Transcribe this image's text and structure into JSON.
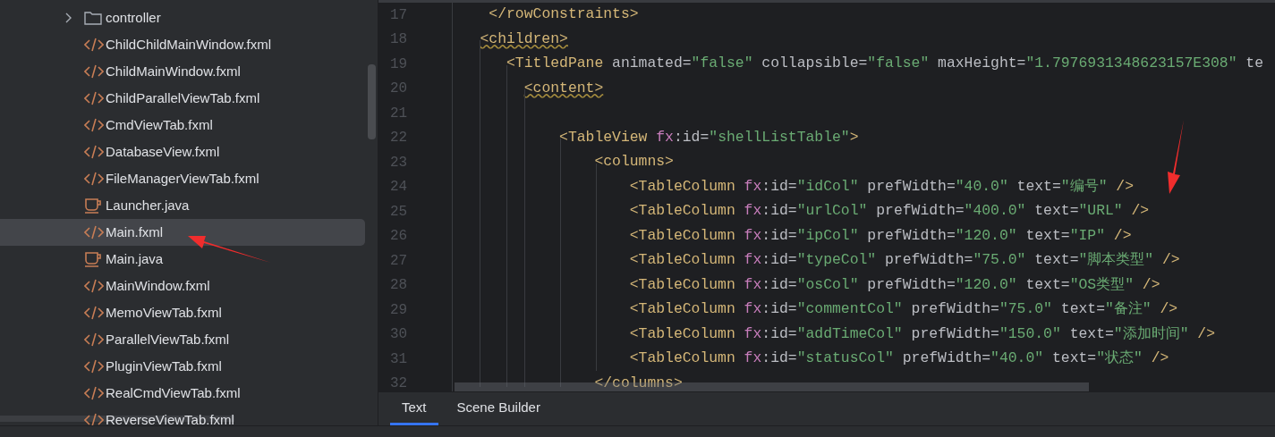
{
  "project_tree": {
    "items": [
      {
        "kind": "folder",
        "label": "controller",
        "expanded": false,
        "selected": false
      },
      {
        "kind": "fxml",
        "label": "ChildChildMainWindow.fxml",
        "selected": false
      },
      {
        "kind": "fxml",
        "label": "ChildMainWindow.fxml",
        "selected": false
      },
      {
        "kind": "fxml",
        "label": "ChildParallelViewTab.fxml",
        "selected": false
      },
      {
        "kind": "fxml",
        "label": "CmdViewTab.fxml",
        "selected": false
      },
      {
        "kind": "fxml",
        "label": "DatabaseView.fxml",
        "selected": false
      },
      {
        "kind": "fxml",
        "label": "FileManagerViewTab.fxml",
        "selected": false
      },
      {
        "kind": "java",
        "label": "Launcher.java",
        "selected": false
      },
      {
        "kind": "fxml",
        "label": "Main.fxml",
        "selected": true
      },
      {
        "kind": "java",
        "label": "Main.java",
        "selected": false
      },
      {
        "kind": "fxml",
        "label": "MainWindow.fxml",
        "selected": false
      },
      {
        "kind": "fxml",
        "label": "MemoViewTab.fxml",
        "selected": false
      },
      {
        "kind": "fxml",
        "label": "ParallelViewTab.fxml",
        "selected": false
      },
      {
        "kind": "fxml",
        "label": "PluginViewTab.fxml",
        "selected": false
      },
      {
        "kind": "fxml",
        "label": "RealCmdViewTab.fxml",
        "selected": false
      },
      {
        "kind": "fxml",
        "label": "ReverseViewTab.fxml",
        "selected": false
      }
    ]
  },
  "editor": {
    "lines": [
      {
        "number": "17",
        "tokens": [
          {
            "kind": "tag",
            "text": "    </rowConstraints>"
          }
        ]
      },
      {
        "number": "18",
        "tokens": [
          {
            "kind": "tag_warn",
            "text": "   <children>"
          }
        ]
      },
      {
        "number": "19",
        "tokens": [
          {
            "kind": "tag",
            "text": "      <TitledPane"
          },
          {
            "kind": "attr",
            "text": " animated="
          },
          {
            "kind": "string",
            "text": "\"false\""
          },
          {
            "kind": "attr",
            "text": " collapsible="
          },
          {
            "kind": "string",
            "text": "\"false\""
          },
          {
            "kind": "attr",
            "text": " maxHeight="
          },
          {
            "kind": "string",
            "text": "\"1.7976931348623157E308\""
          },
          {
            "kind": "attr",
            "text": " te"
          }
        ]
      },
      {
        "number": "20",
        "tokens": [
          {
            "kind": "tag_warn",
            "text": "        <content>"
          }
        ]
      },
      {
        "number": "21"
      },
      {
        "number": "22",
        "tokens": [
          {
            "kind": "tag",
            "text": "            <TableView "
          },
          {
            "kind": "ns",
            "text": "fx"
          },
          {
            "kind": "attr",
            "text": ":id="
          },
          {
            "kind": "string",
            "text": "\"shellListTable\""
          },
          {
            "kind": "tag",
            "text": ">"
          }
        ]
      },
      {
        "number": "23",
        "tokens": [
          {
            "kind": "tag",
            "text": "                <columns>"
          }
        ]
      },
      {
        "number": "24",
        "tokens": [
          {
            "kind": "tag",
            "text": "                    <TableColumn "
          },
          {
            "kind": "ns",
            "text": "fx"
          },
          {
            "kind": "attr",
            "text": ":id="
          },
          {
            "kind": "string",
            "text": "\"idCol\""
          },
          {
            "kind": "attr",
            "text": " prefWidth="
          },
          {
            "kind": "string",
            "text": "\"40.0\""
          },
          {
            "kind": "attr",
            "text": " text="
          },
          {
            "kind": "string",
            "text": "\"编号\""
          },
          {
            "kind": "tag",
            "text": " />"
          }
        ]
      },
      {
        "number": "25",
        "tokens": [
          {
            "kind": "tag",
            "text": "                    <TableColumn "
          },
          {
            "kind": "ns",
            "text": "fx"
          },
          {
            "kind": "attr",
            "text": ":id="
          },
          {
            "kind": "string",
            "text": "\"urlCol\""
          },
          {
            "kind": "attr",
            "text": " prefWidth="
          },
          {
            "kind": "string",
            "text": "\"400.0\""
          },
          {
            "kind": "attr",
            "text": " text="
          },
          {
            "kind": "string",
            "text": "\"URL\""
          },
          {
            "kind": "tag",
            "text": " />"
          }
        ]
      },
      {
        "number": "26",
        "tokens": [
          {
            "kind": "tag",
            "text": "                    <TableColumn "
          },
          {
            "kind": "ns",
            "text": "fx"
          },
          {
            "kind": "attr",
            "text": ":id="
          },
          {
            "kind": "string",
            "text": "\"ipCol\""
          },
          {
            "kind": "attr",
            "text": " prefWidth="
          },
          {
            "kind": "string",
            "text": "\"120.0\""
          },
          {
            "kind": "attr",
            "text": " text="
          },
          {
            "kind": "string",
            "text": "\"IP\""
          },
          {
            "kind": "tag",
            "text": " />"
          }
        ]
      },
      {
        "number": "27",
        "tokens": [
          {
            "kind": "tag",
            "text": "                    <TableColumn "
          },
          {
            "kind": "ns",
            "text": "fx"
          },
          {
            "kind": "attr",
            "text": ":id="
          },
          {
            "kind": "string",
            "text": "\"typeCol\""
          },
          {
            "kind": "attr",
            "text": " prefWidth="
          },
          {
            "kind": "string",
            "text": "\"75.0\""
          },
          {
            "kind": "attr",
            "text": " text="
          },
          {
            "kind": "string",
            "text": "\"脚本类型\""
          },
          {
            "kind": "tag",
            "text": " />"
          }
        ]
      },
      {
        "number": "28",
        "tokens": [
          {
            "kind": "tag",
            "text": "                    <TableColumn "
          },
          {
            "kind": "ns",
            "text": "fx"
          },
          {
            "kind": "attr",
            "text": ":id="
          },
          {
            "kind": "string",
            "text": "\"osCol\""
          },
          {
            "kind": "attr",
            "text": " prefWidth="
          },
          {
            "kind": "string",
            "text": "\"120.0\""
          },
          {
            "kind": "attr",
            "text": " text="
          },
          {
            "kind": "string",
            "text": "\"OS类型\""
          },
          {
            "kind": "tag",
            "text": " />"
          }
        ]
      },
      {
        "number": "29",
        "tokens": [
          {
            "kind": "tag",
            "text": "                    <TableColumn "
          },
          {
            "kind": "ns",
            "text": "fx"
          },
          {
            "kind": "attr",
            "text": ":id="
          },
          {
            "kind": "string",
            "text": "\"commentCol\""
          },
          {
            "kind": "attr",
            "text": " prefWidth="
          },
          {
            "kind": "string",
            "text": "\"75.0\""
          },
          {
            "kind": "attr",
            "text": " text="
          },
          {
            "kind": "string",
            "text": "\"备注\""
          },
          {
            "kind": "tag",
            "text": " />"
          }
        ]
      },
      {
        "number": "30",
        "tokens": [
          {
            "kind": "tag",
            "text": "                    <TableColumn "
          },
          {
            "kind": "ns",
            "text": "fx"
          },
          {
            "kind": "attr",
            "text": ":id="
          },
          {
            "kind": "string",
            "text": "\"addTimeCol\""
          },
          {
            "kind": "attr",
            "text": " prefWidth="
          },
          {
            "kind": "string",
            "text": "\"150.0\""
          },
          {
            "kind": "attr",
            "text": " text="
          },
          {
            "kind": "string",
            "text": "\"添加时间\""
          },
          {
            "kind": "tag",
            "text": " />"
          }
        ]
      },
      {
        "number": "31",
        "tokens": [
          {
            "kind": "tag",
            "text": "                    <TableColumn "
          },
          {
            "kind": "ns",
            "text": "fx"
          },
          {
            "kind": "attr",
            "text": ":id="
          },
          {
            "kind": "string",
            "text": "\"statusCol\""
          },
          {
            "kind": "attr",
            "text": " prefWidth="
          },
          {
            "kind": "string",
            "text": "\"40.0\""
          },
          {
            "kind": "attr",
            "text": " text="
          },
          {
            "kind": "string",
            "text": "\"状态\""
          },
          {
            "kind": "tag",
            "text": " />"
          }
        ]
      },
      {
        "number": "32",
        "tokens": [
          {
            "kind": "tag",
            "text": "                </columns>"
          }
        ]
      }
    ]
  },
  "editor_tabs": [
    {
      "label": "Text",
      "selected": true
    },
    {
      "label": "Scene Builder",
      "selected": false
    }
  ]
}
